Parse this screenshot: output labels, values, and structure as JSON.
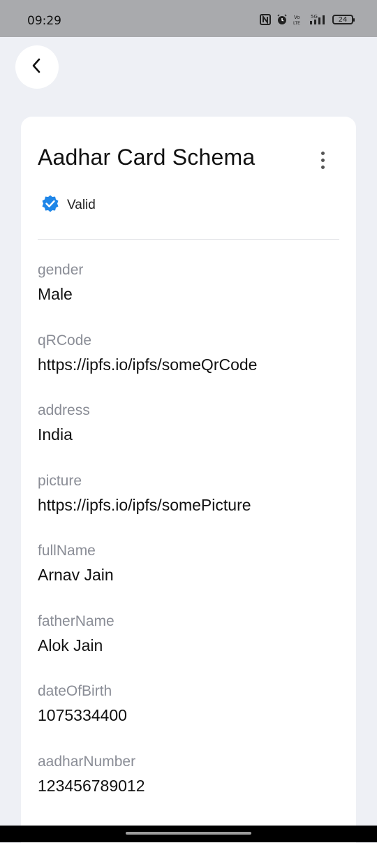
{
  "status_bar": {
    "time": "09:29",
    "icons": [
      "nfc-icon",
      "alarm-icon",
      "volte-icon",
      "signal-5g-icon"
    ],
    "volte_label": "Vo\nLTE",
    "network_label": "5G",
    "battery": "24"
  },
  "header": {
    "back_icon": "chevron-left-icon"
  },
  "card": {
    "title": "Aadhar Card Schema",
    "menu_icon": "more-vertical-icon",
    "status": {
      "label": "Valid",
      "icon": "verified-badge-icon",
      "color": "#1f86e8"
    },
    "fields": [
      {
        "label": "gender",
        "value": "Male"
      },
      {
        "label": "qRCode",
        "value": "https://ipfs.io/ipfs/someQrCode"
      },
      {
        "label": "address",
        "value": "India"
      },
      {
        "label": "picture",
        "value": "https://ipfs.io/ipfs/somePicture"
      },
      {
        "label": "fullName",
        "value": "Arnav Jain"
      },
      {
        "label": "fatherName",
        "value": "Alok Jain"
      },
      {
        "label": "dateOfBirth",
        "value": "1075334400"
      },
      {
        "label": "aadharNumber",
        "value": "123456789012"
      }
    ]
  }
}
